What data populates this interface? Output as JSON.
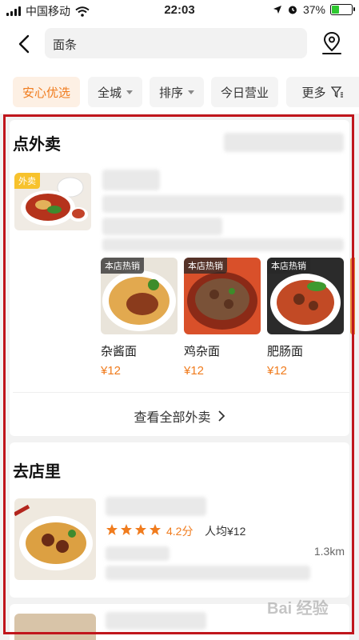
{
  "status_bar": {
    "carrier": "中国移动",
    "time": "22:03",
    "battery": "37%",
    "battery_level": 0.37
  },
  "search": {
    "query": "面条"
  },
  "filters": [
    {
      "label": "安心优选",
      "active": true,
      "caret": false
    },
    {
      "label": "全城",
      "active": false,
      "caret": true
    },
    {
      "label": "排序",
      "active": false,
      "caret": true
    },
    {
      "label": "今日营业",
      "active": false,
      "caret": false
    },
    {
      "label": "更多",
      "active": false,
      "caret": false
    }
  ],
  "takeout": {
    "title": "点外卖",
    "shop_tag": "外卖",
    "dishes": [
      {
        "badge": "本店热销",
        "name": "杂酱面",
        "price": "¥12"
      },
      {
        "badge": "本店热销",
        "name": "鸡杂面",
        "price": "¥12"
      },
      {
        "badge": "本店热销",
        "name": "肥肠面",
        "price": "¥12"
      }
    ],
    "view_all": "查看全部外卖"
  },
  "store": {
    "title": "去店里",
    "rating_value": 4.2,
    "rating": "4.2分",
    "avg_price": "人均¥12",
    "distance": "1.3km"
  },
  "watermark": "Bai 经验",
  "colors": {
    "accent": "#f07c1e",
    "frame": "#c0161c"
  }
}
